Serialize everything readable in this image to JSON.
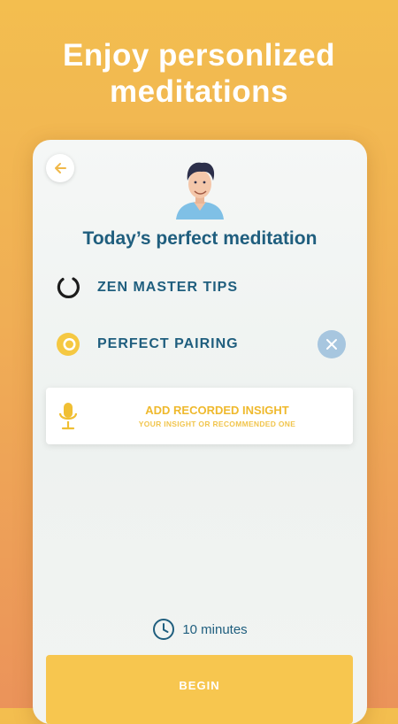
{
  "headline": {
    "line1": "Enjoy personlized",
    "line2": "meditations"
  },
  "card": {
    "title": "Today’s perfect meditation",
    "back_icon": "arrow-left-icon",
    "avatar": "guide-avatar-illustration",
    "items": [
      {
        "label": "ZEN MASTER TIPS",
        "icon": "enso-circle-icon"
      },
      {
        "label": "PERFECT PAIRING",
        "icon": "yellow-ring-icon",
        "action_icon": "close-icon"
      }
    ],
    "insight": {
      "title": "ADD RECORDED INSIGHT",
      "subtitle": "YOUR INSIGHT OR RECOMMENDED ONE",
      "icon": "microphone-icon"
    },
    "duration": {
      "text": "10 minutes",
      "icon": "clock-icon"
    },
    "begin_label": "BEGIN"
  },
  "colors": {
    "accent_yellow": "#f7c64f",
    "title_blue": "#1f5e7e",
    "remove_button": "#a7c6df",
    "background_top": "#f3be4f",
    "background_bottom": "#eb935a"
  }
}
